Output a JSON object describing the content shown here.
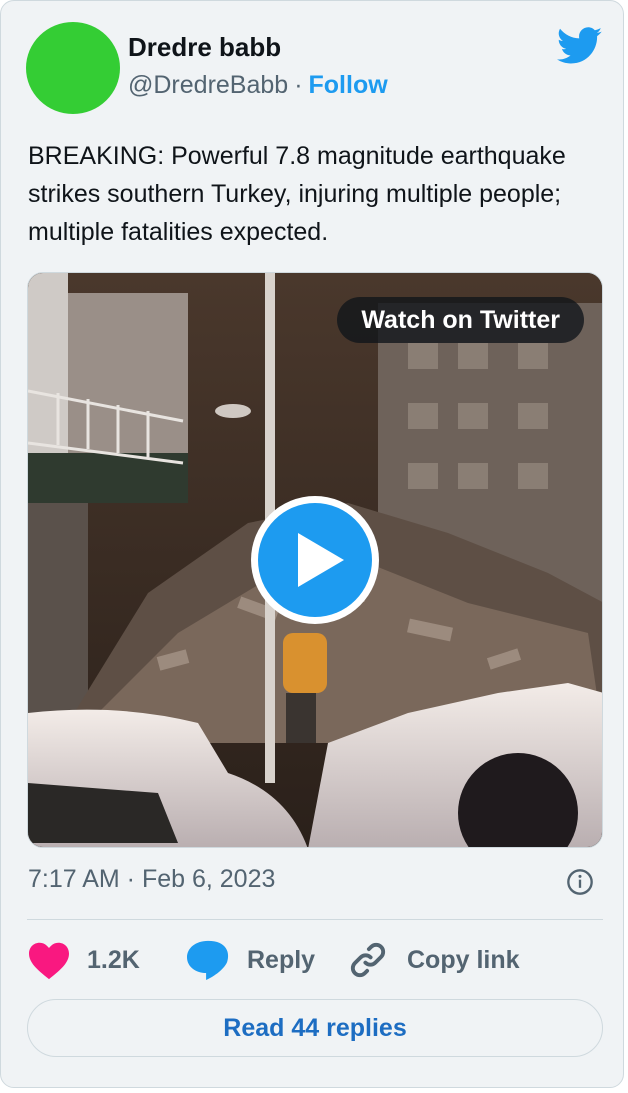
{
  "author": {
    "name": "Dredre babb",
    "handle": "@DredreBabb",
    "separator": "·",
    "follow_label": "Follow",
    "avatar_color": "#34cd34"
  },
  "tweet": {
    "text": "BREAKING: Powerful 7.8 magnitude earthquake strikes southern Turkey, injuring multiple people; multiple fatalities expected."
  },
  "media": {
    "watch_label": "Watch on Twitter",
    "play_icon": "play-icon"
  },
  "meta": {
    "timestamp": "7:17 AM · Feb 6, 2023",
    "info_icon": "info-icon"
  },
  "actions": {
    "like_count": "1.2K",
    "reply_label": "Reply",
    "copy_label": "Copy link"
  },
  "read_replies_label": "Read 44 replies",
  "colors": {
    "brand": "#1d9bf0",
    "like": "#f91880",
    "link": "#1d6dc2",
    "card_bg": "#f0f3f5",
    "muted": "#536471"
  }
}
